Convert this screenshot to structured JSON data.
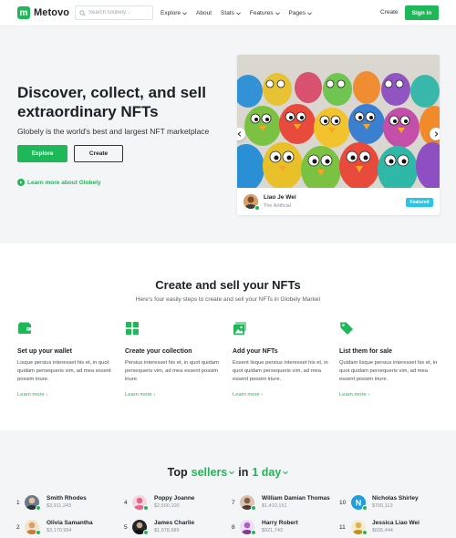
{
  "brand": {
    "name": "Metovo",
    "mark": "m"
  },
  "search": {
    "placeholder": "Search Globely..."
  },
  "nav": {
    "items": [
      {
        "label": "Explore",
        "has_dropdown": true
      },
      {
        "label": "About",
        "has_dropdown": false
      },
      {
        "label": "Stats",
        "has_dropdown": true
      },
      {
        "label": "Features",
        "has_dropdown": true
      },
      {
        "label": "Pages",
        "has_dropdown": true
      }
    ],
    "create_label": "Create",
    "signin_label": "Sign in"
  },
  "hero": {
    "title": "Discover, collect, and sell extraordinary NFTs",
    "subtitle": "Globely is the world's best and largest NFT marketplace",
    "explore_label": "Explore",
    "create_label": "Create",
    "learn_more_label": "Learn more about Globely",
    "card": {
      "author": "Liao Je Wei",
      "collection": "The Artificial",
      "badge": "Featured"
    }
  },
  "steps": {
    "title": "Create and sell your NFTs",
    "subtitle": "Here's four easily steps to create and sell your NFTs in Globely Market",
    "items": [
      {
        "icon": "wallet-icon",
        "title": "Set up your wallet",
        "text": "Lisque persius interesset his et, in quot quidam persequeris vim, ad mea essent possim iriure.",
        "link": "Learn more"
      },
      {
        "icon": "grid-icon",
        "title": "Create your collection",
        "text": "Persius interesset his et, in quot quidam persequeris vim, ad mea essent possim iriure.",
        "link": "Learn more"
      },
      {
        "icon": "image-icon",
        "title": "Add your NFTs",
        "text": "Essent lisque persius interesset his et, in quot quidam persequeris vim, ad mea essent possim iriure.",
        "link": "Learn more"
      },
      {
        "icon": "tags-icon",
        "title": "List them for sale",
        "text": "Quidam lisque persius interesset his et, in quot quidam persequeris vim, ad mea essent possim iriure.",
        "link": "Learn more"
      }
    ]
  },
  "sellers": {
    "title_prefix": "Top",
    "title_category": "sellers",
    "title_in": "in",
    "title_period": "1 day",
    "list": [
      {
        "rank": "1",
        "name": "Smith Rhodes",
        "amount": "$3,911,243",
        "avatar_color": "#6c7a89"
      },
      {
        "rank": "2",
        "name": "Olivia Samantha",
        "amount": "$3,170,994",
        "avatar_color": "#d9a066"
      },
      {
        "rank": "4",
        "name": "Poppy Joanne",
        "amount": "$2,500,100",
        "avatar_color": "#e06a8c"
      },
      {
        "rank": "5",
        "name": "James Charlie",
        "amount": "$1,978,989",
        "avatar_color": "#22262b"
      },
      {
        "rank": "7",
        "name": "William Damian Thomas",
        "amount": "$1,410,151",
        "avatar_color": "#8a5a44"
      },
      {
        "rank": "8",
        "name": "Harry Robert",
        "amount": "$921,743",
        "avatar_color": "#b25ac9"
      },
      {
        "rank": "10",
        "name": "Nicholas Shirley",
        "amount": "$700,113",
        "avatar_color": "#1e9ee0"
      },
      {
        "rank": "11",
        "name": "Jessica Liao Wei",
        "amount": "$655,444",
        "avatar_color": "#e0b44a"
      }
    ]
  },
  "colors": {
    "accent": "#1fb858",
    "badge": "#29c5e8",
    "section_bg": "#f4f5f7",
    "text": "#1c2126"
  }
}
